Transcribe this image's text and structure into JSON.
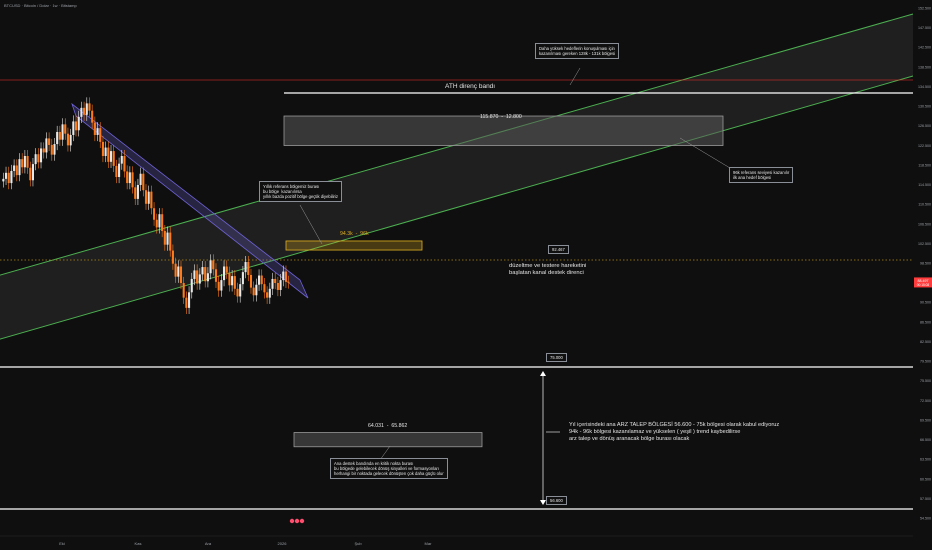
{
  "header": {
    "symbol": "BTCUSD · Bitcoin / Dolar · 1w · Bitstamp"
  },
  "colors": {
    "background": "#0f0f0f",
    "channel_line": "#4caf50",
    "channel_fill": "#5a5a5a",
    "candle_up": "#e8e8e8",
    "candle_down": "#ff7a1a",
    "ath_line": "#ff2f2f",
    "wedge": "#6f63d8",
    "price_badge": "#ff3b3b"
  },
  "chart_data": {
    "type": "candlestick",
    "title": "",
    "y_axis": {
      "scale": "log",
      "ylim": [
        54000,
        154000
      ],
      "ticks": [
        "152.500",
        "147.500",
        "142.500",
        "138.500",
        "134.500",
        "130.500",
        "126.500",
        "122.500",
        "118.500",
        "114.500",
        "110.500",
        "106.500",
        "102.500",
        "98.500",
        "94.500",
        "90.500",
        "86.500",
        "82.500",
        "79.500",
        "75.500",
        "72.500",
        "69.500",
        "66.500",
        "63.500",
        "60.500",
        "57.500",
        "54.500"
      ]
    },
    "x_axis": {
      "ticks": [
        "Eki",
        "Kas",
        "Ara",
        "2026",
        "Şub",
        "Mar"
      ]
    },
    "current_price": {
      "badge": "88.497",
      "sub": "00:15:08",
      "value": 88497
    },
    "reference_lines": [
      {
        "label": "ATH direnç bandı",
        "value": 131000,
        "color": "#ff2f2f",
        "style": "solid-thin"
      },
      {
        "label": "128.500",
        "value": 128500,
        "color": "#ffffff",
        "style": "solid"
      },
      {
        "label": "75.000",
        "value": 75000,
        "color": "#ffffff",
        "style": "solid"
      },
      {
        "label": "56.600",
        "value": 56600,
        "color": "#ffffff",
        "style": "solid"
      },
      {
        "label": "92.467",
        "value": 92467,
        "color": "#b38a1a",
        "style": "dotted"
      }
    ],
    "zones": [
      {
        "label": "115.870 - 12.800",
        "from": 115870,
        "to": 122800,
        "color": "#5a5a5a"
      },
      {
        "label": "94.3k - 96k",
        "from": 94300,
        "to": 96000,
        "color": "#e0b020"
      },
      {
        "label": "64.031 - 65.862",
        "from": 64031,
        "to": 65862,
        "color": "#5a5a5a"
      }
    ],
    "candles": {
      "start_price": 108500,
      "closes": [
        108500,
        109800,
        107600,
        110200,
        111400,
        109300,
        112800,
        111000,
        113500,
        110900,
        108200,
        111700,
        113900,
        112100,
        115200,
        114300,
        117500,
        116000,
        113800,
        116200,
        119000,
        117200,
        120800,
        118600,
        115900,
        118300,
        121500,
        119400,
        122600,
        124800,
        123100,
        125900,
        124100,
        121200,
        118300,
        119900,
        116700,
        113500,
        115400,
        112200,
        114600,
        111300,
        108900,
        111800,
        113500,
        110100,
        107600,
        109900,
        106700,
        104300,
        107200,
        109600,
        106100,
        103300,
        105800,
        102400,
        100100,
        98600,
        101200,
        97900,
        95300,
        97600,
        94200,
        91800,
        89500,
        91300,
        88400,
        85900,
        84200,
        86800,
        89100,
        90600,
        88300,
        89900,
        91200,
        88700,
        90100,
        92400,
        90800,
        88600,
        87100,
        88900,
        91300,
        90200,
        88000,
        89600,
        87400,
        86100,
        88200,
        90300,
        92100,
        89800,
        87600,
        86300,
        88100,
        89700,
        88200,
        86800,
        85900,
        87400,
        89100,
        88400,
        87200,
        88900,
        90400,
        88600,
        88497
      ]
    }
  },
  "annotations": {
    "top_note": "Daha yüksek hedeflerin konuşulması için\nkazanılması gereken 128k - 131k bölgesi",
    "ath_label": "ATH direnç bandı",
    "zone_high_label": "115.870  -  12.800",
    "right_note": "96k referans seviyesi kazanılır\nilk ana hedef bölgesi",
    "yearly_note": "Yıllık referans bölgemiz burası\nbu bölge  kazanılırsa\nyıllık bazda pozitif bölge geçtik diyebiliriz",
    "zone_mid_label": "94.3k  -  96k",
    "level_92_tag": "92.467",
    "channel_note_line1": "düzeltme ve testere hareketini",
    "channel_note_line2": "başlatan kanal destek direnci",
    "level_75_tag": "75.000",
    "level_56_tag": "56.600",
    "demand_note_line1": "Yıl içerisindeki ana ARZ TALEP BÖLGESİ 56.600 - 75k bölgesi olarak kabul ediyoruz",
    "demand_note_line2": "94k - 96k bölgesi kazanılamaz ve yükselen ( yeşil ) trend kaybedilirse",
    "demand_note_line3": "arz talep ve dönüş aranacak bölge burası olacak",
    "zone_low_label": "64.031  -  65.862",
    "bottom_note": "Ana destek bandında en kritik nokta burası\nbu bölgede gelebilecek dönüş sinyalleri ve formasyonları\nherhangi bir noktada gelecek dönüşten çok daha güçlü olur"
  }
}
